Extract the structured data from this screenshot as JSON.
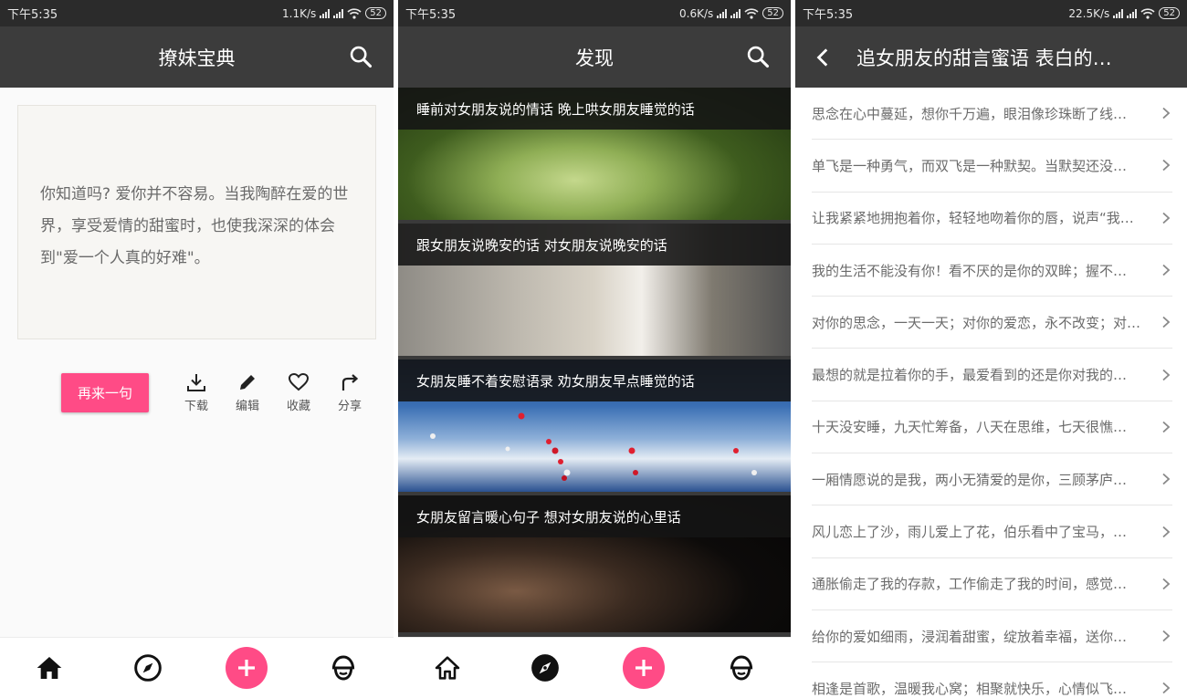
{
  "status": {
    "time": "下午5:35",
    "speeds": [
      "1.1K/s",
      "0.6K/s",
      "22.5K/s"
    ],
    "battery": "52"
  },
  "screen1": {
    "title": "撩妹宝典",
    "quote": "你知道吗? 爱你并不容易。当我陶醉在爱的世界，享受爱情的甜蜜时，也使我深深的体会到\"爱一个人真的好难\"。",
    "again_label": "再来一句",
    "actions": [
      {
        "label": "下载",
        "icon": "download-icon"
      },
      {
        "label": "编辑",
        "icon": "pencil-icon"
      },
      {
        "label": "收藏",
        "icon": "heart-icon"
      },
      {
        "label": "分享",
        "icon": "share-icon"
      }
    ]
  },
  "screen2": {
    "title": "发现",
    "items": [
      {
        "caption": "睡前对女朋友说的情话 晚上哄女朋友睡觉的话"
      },
      {
        "caption": "跟女朋友说晚安的话 对女朋友说晚安的话"
      },
      {
        "caption": "女朋友睡不着安慰语录 劝女朋友早点睡觉的话"
      },
      {
        "caption": "女朋友留言暖心句子 想对女朋友说的心里话"
      }
    ]
  },
  "screen3": {
    "title": "追女朋友的甜言蜜语 表白的…",
    "rows": [
      "思念在心中蔓延，想你千万遍，眼泪像珍珠断了线…",
      "单飞是一种勇气，而双飞是一种默契。当默契还没…",
      "让我紧紧地拥抱着你，轻轻地吻着你的唇，说声“我…",
      "我的生活不能没有你！看不厌的是你的双眸；握不…",
      "对你的思念，一天一天；对你的爱恋，永不改变；对…",
      "最想的就是拉着你的手，最爱看到的还是你对我的…",
      "十天没安睡，九天忙筹备，八天在思维，七天很憔…",
      "一厢情愿说的是我，两小无猜爱的是你，三顾茅庐…",
      "风儿恋上了沙，雨儿爱上了花，伯乐看中了宝马，…",
      "通胀偷走了我的存款，工作偷走了我的时间，感觉…",
      "给你的爱如细雨，浸润着甜蜜，绽放着幸福，送你…",
      "相逢是首歌，温暖我心窝；相聚就快乐，心情似飞…"
    ]
  },
  "colors": {
    "accent": "#ff4b86",
    "appbar": "#3c3c3c",
    "statusbar": "#2b2b2b"
  }
}
